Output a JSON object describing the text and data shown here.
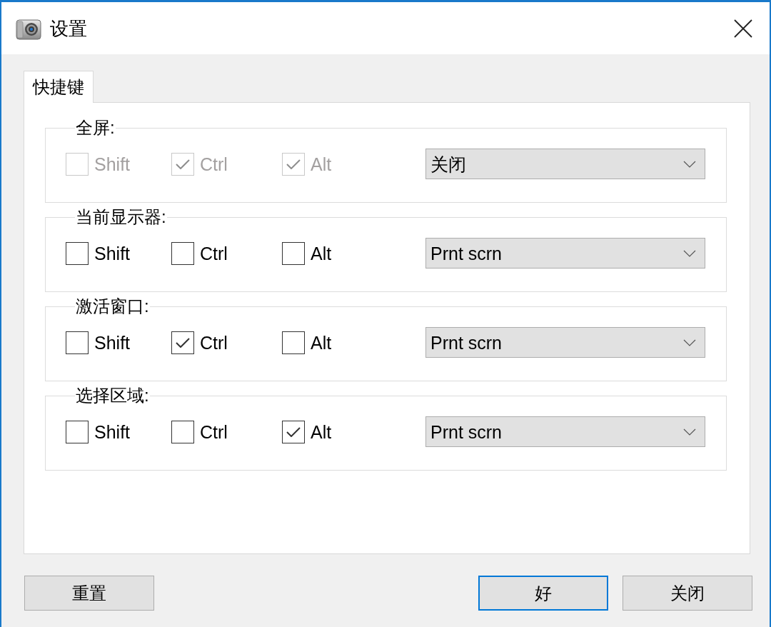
{
  "window": {
    "title": "设置"
  },
  "tabs": [
    {
      "label": "快捷键",
      "selected": true
    }
  ],
  "groups": [
    {
      "label": "全屏:",
      "modifiers": [
        {
          "label": "Shift",
          "checked": false,
          "disabled": true
        },
        {
          "label": "Ctrl",
          "checked": true,
          "disabled": true
        },
        {
          "label": "Alt",
          "checked": true,
          "disabled": true
        }
      ],
      "key": "关闭"
    },
    {
      "label": "当前显示器:",
      "modifiers": [
        {
          "label": "Shift",
          "checked": false,
          "disabled": false
        },
        {
          "label": "Ctrl",
          "checked": false,
          "disabled": false
        },
        {
          "label": "Alt",
          "checked": false,
          "disabled": false
        }
      ],
      "key": "Prnt scrn"
    },
    {
      "label": "激活窗口:",
      "modifiers": [
        {
          "label": "Shift",
          "checked": false,
          "disabled": false
        },
        {
          "label": "Ctrl",
          "checked": true,
          "disabled": false
        },
        {
          "label": "Alt",
          "checked": false,
          "disabled": false
        }
      ],
      "key": "Prnt scrn"
    },
    {
      "label": "选择区域:",
      "modifiers": [
        {
          "label": "Shift",
          "checked": false,
          "disabled": false
        },
        {
          "label": "Ctrl",
          "checked": false,
          "disabled": false
        },
        {
          "label": "Alt",
          "checked": true,
          "disabled": false
        }
      ],
      "key": "Prnt scrn"
    }
  ],
  "buttons": [
    {
      "label": "重置",
      "default": false
    },
    {
      "label": "好",
      "default": true
    },
    {
      "label": "关闭",
      "default": false
    }
  ]
}
